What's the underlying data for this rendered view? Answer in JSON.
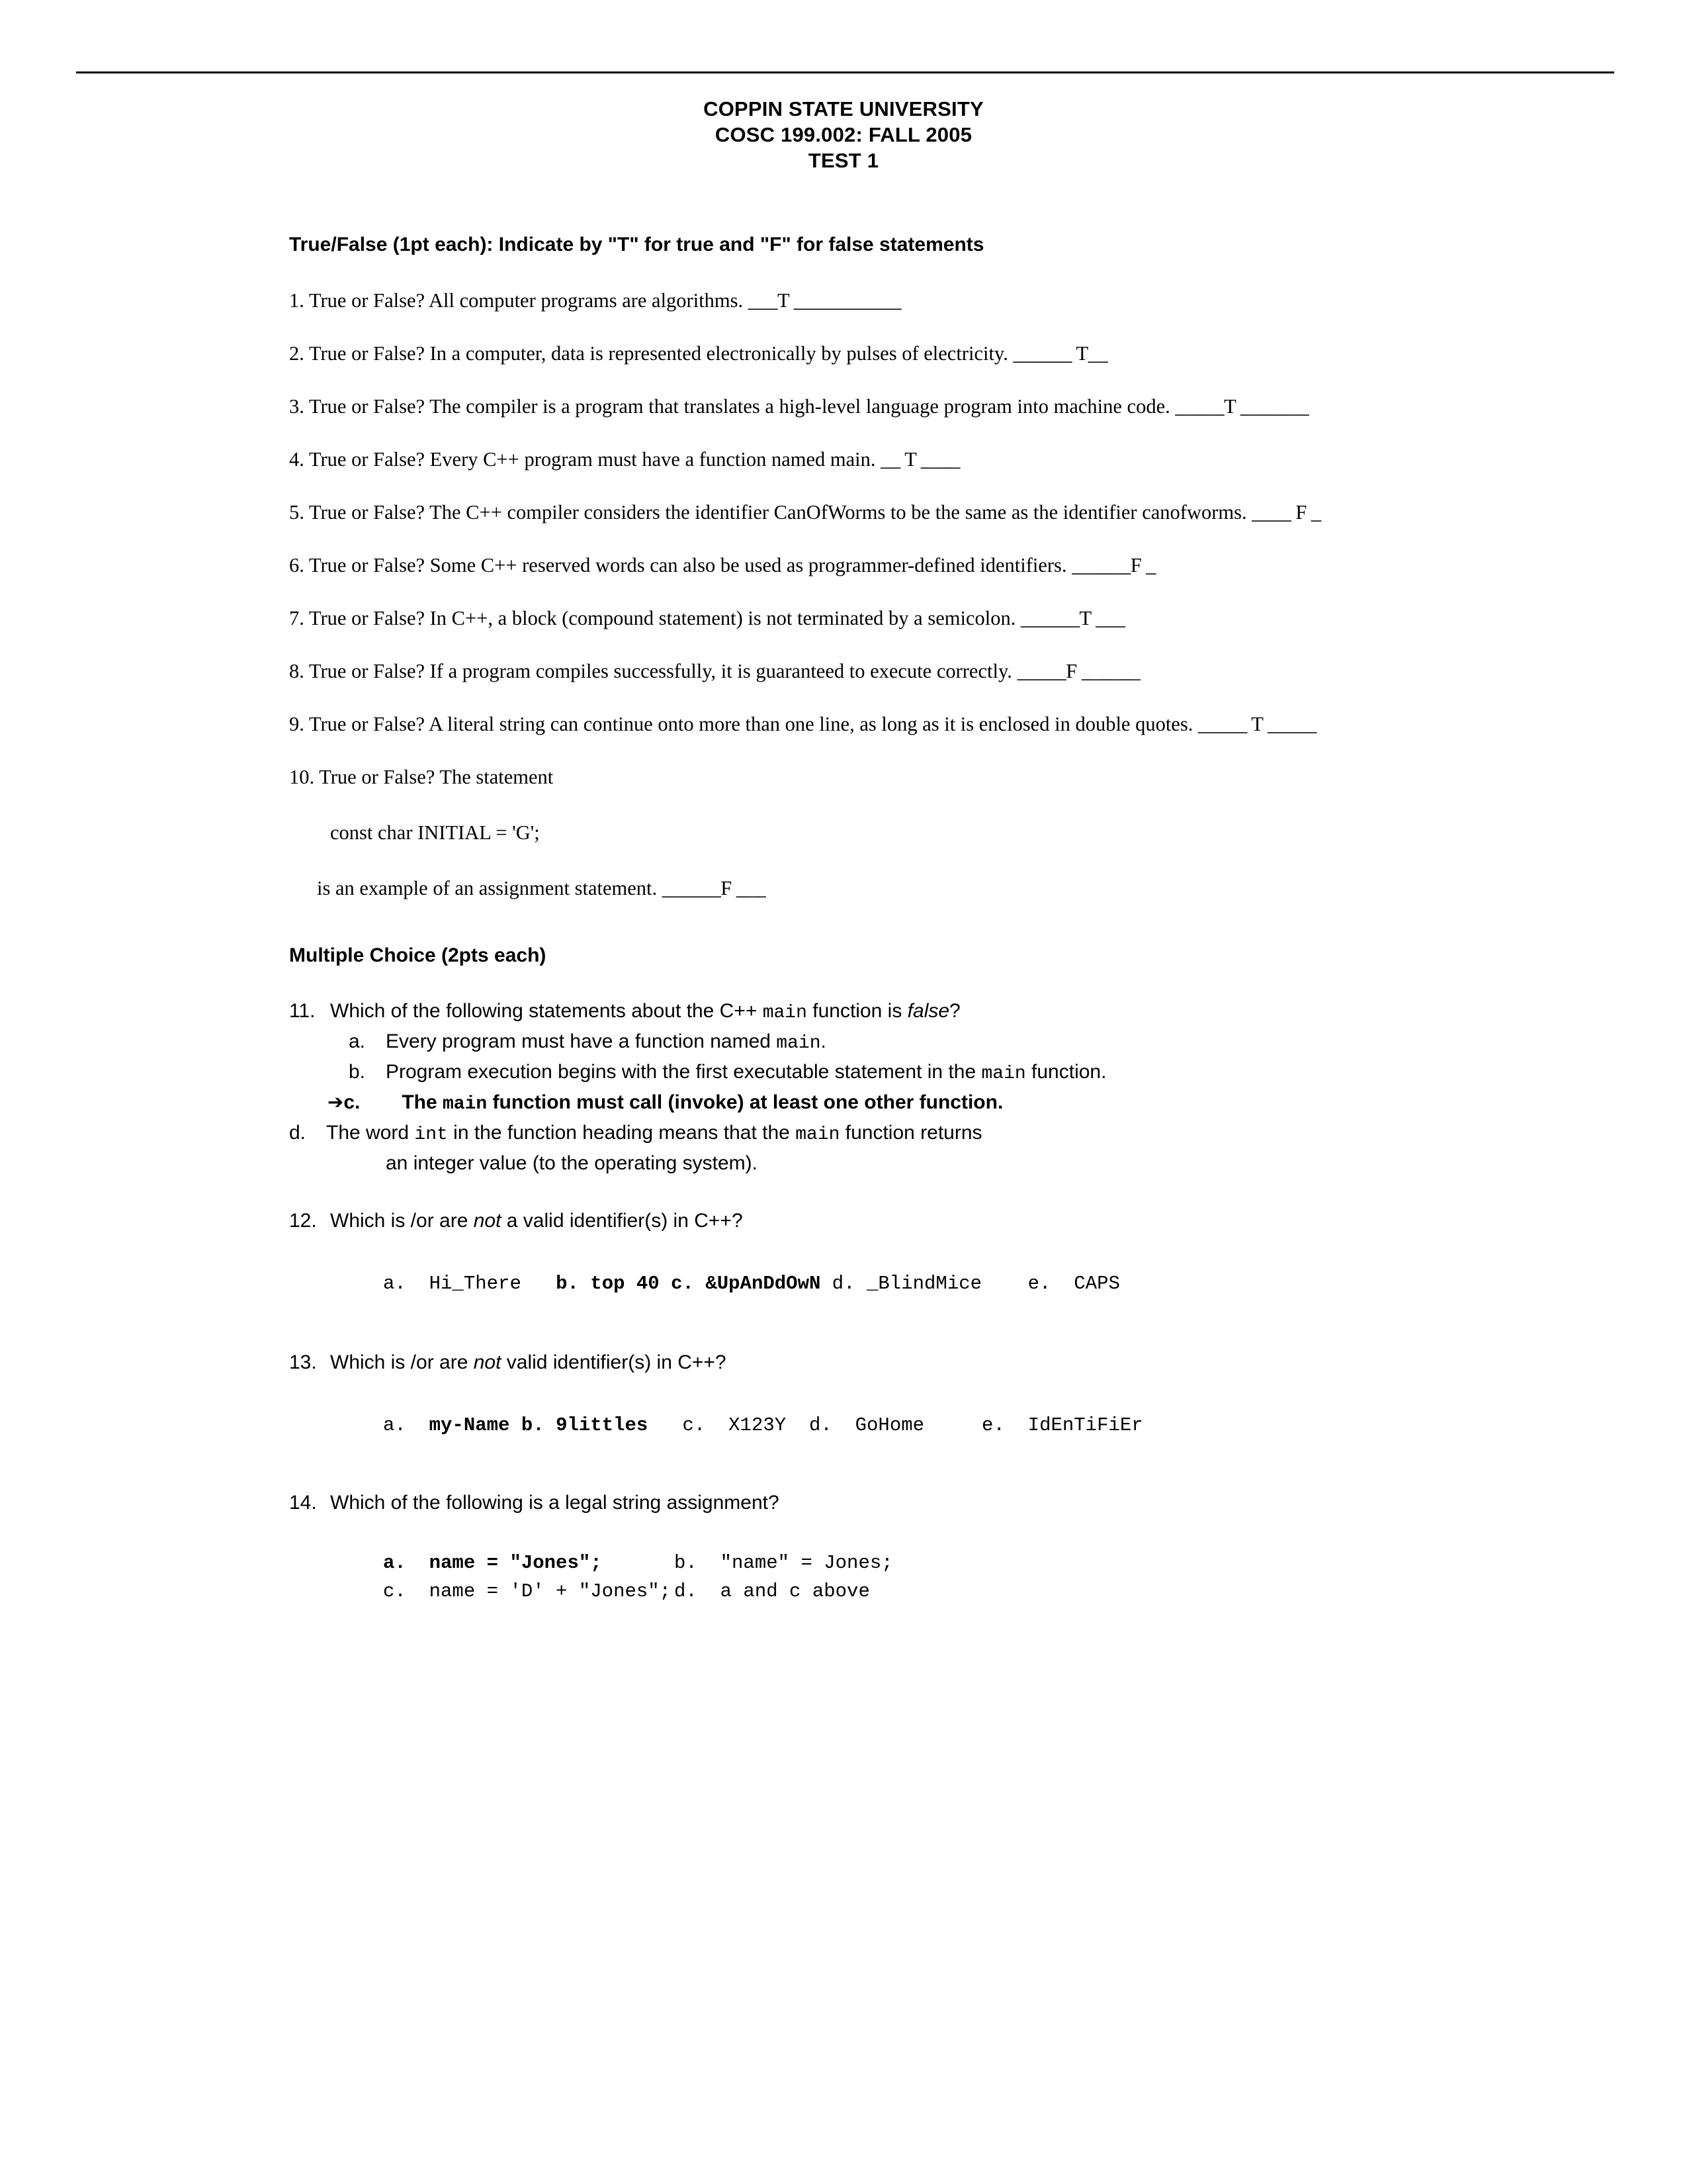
{
  "header": {
    "title_lines": [
      "COPPIN STATE UNIVERSITY",
      "COSC 199.002: FALL 2005",
      "TEST 1"
    ]
  },
  "true_false": {
    "section_heading": "True/False (1pt each): Indicate by \"T\" for true and \"F\" for false statements",
    "items": [
      {
        "number": "1.",
        "text": "True or False? All computer programs are algorithms.",
        "answer_marks": "___T ___________"
      },
      {
        "number": "2.",
        "text": "True or False? In a computer, data is represented electronically by pulses of electricity.",
        "answer_marks": "______ T__"
      },
      {
        "number": "3.",
        "text": "True or False? The compiler is a program that translates a high-level language program into machine code.",
        "answer_marks": "_____T _______"
      },
      {
        "number": "4.",
        "text": "True or False?  Every C++ program must have a function named main.",
        "answer_marks": "__ T ____"
      },
      {
        "number": "5.",
        "text": "True or False? The C++ compiler considers the identifier CanOfWorms to be the same as the identifier canofworms.",
        "answer_marks": "____ F _"
      },
      {
        "number": "6.",
        "text": "True or False? Some C++ reserved words can also be used as programmer-defined identifiers.",
        "answer_marks": "______F _"
      },
      {
        "number": "7.",
        "text": "True or False? In C++, a block (compound statement) is not terminated by a semicolon.",
        "answer_marks": "______T ___"
      },
      {
        "number": "8.",
        "text": "True or False? If a program compiles successfully, it is guaranteed to execute correctly.",
        "answer_marks": "_____F ______"
      },
      {
        "number": "9.",
        "text": "True or False? A literal string can continue onto more than one line, as long as it is enclosed in double quotes.",
        "answer_marks": "_____ T _____"
      }
    ],
    "item10": {
      "number": "10.",
      "text": "True or False? The statement",
      "code": "const char INITIAL = 'G';",
      "continuation": "is an example of an assignment statement.",
      "answer_marks": "______F ___"
    }
  },
  "multiple_choice": {
    "section_heading": "Multiple Choice (2pts each)",
    "q11": {
      "number": "11.",
      "stem_part1": "Which of the following statements about the C++ ",
      "stem_mono": "main",
      "stem_part2": " function is ",
      "stem_italic": "false",
      "stem_part3": "?",
      "options": [
        {
          "label": "a.",
          "text_part1": "Every program must have a function named ",
          "mono": "main",
          "text_part2": "."
        },
        {
          "label": "b.",
          "text_part1": "Program execution begins with the first executable statement in the ",
          "mono": "main",
          "text_part2": " function."
        },
        {
          "label": "c.",
          "arrow": "➔",
          "bold": true,
          "text_part1": "The ",
          "mono": "main",
          "text_part2": " function must call (invoke) at least one other function."
        },
        {
          "label": "d.",
          "text_part1": "The word ",
          "mono": "int",
          "text_part2": " in the function heading means that the ",
          "mono2": "main",
          "text_part3": " function returns",
          "text_line2": "an integer value (to the operating system)."
        }
      ]
    },
    "q12": {
      "number": "12.",
      "stem_part1": "Which is /or are ",
      "stem_italic": "not",
      "stem_part2": " a valid identifier(s) in C++?",
      "options": [
        {
          "label": "a.",
          "value": "Hi_There",
          "bold": false
        },
        {
          "label": "b.",
          "value": "top 40",
          "bold": true
        },
        {
          "label": "c.",
          "value": "&UpAnDdOwN",
          "bold": true
        },
        {
          "label": "d.",
          "value": "_BlindMice",
          "bold": false
        },
        {
          "label": "e.",
          "value": "CAPS",
          "bold": false
        }
      ]
    },
    "q13": {
      "number": "13.",
      "stem_part1": "Which is /or are ",
      "stem_italic": "not",
      "stem_part2": "  valid identifier(s) in C++?",
      "options": [
        {
          "label": "a.",
          "value": "my-Name",
          "bold": true
        },
        {
          "label": "b.",
          "value": "9littles",
          "bold": true
        },
        {
          "label": "c.",
          "value": "X123Y",
          "bold": false
        },
        {
          "label": "d.",
          "value": "GoHome",
          "bold": false
        },
        {
          "label": "e.",
          "value": "IdEnTiFiEr",
          "bold": false
        }
      ]
    },
    "q14": {
      "number": "14.",
      "stem": "Which of the following is a legal string assignment?",
      "options": [
        {
          "label": "a.",
          "value": "name = \"Jones\";",
          "bold": true
        },
        {
          "label": "b.",
          "value": "\"name\" = Jones;",
          "bold": false
        },
        {
          "label": "c.",
          "value": "name = 'D' + \"Jones\";",
          "bold": false
        },
        {
          "label": "d.",
          "value": "a and c above",
          "bold": false
        }
      ]
    }
  }
}
